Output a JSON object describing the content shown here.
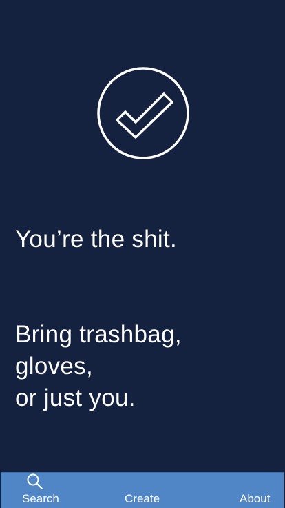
{
  "screen": {
    "background_color": "#15223f",
    "icon": "checkmark-circle-icon"
  },
  "message": {
    "headline": "You’re the shit.",
    "instruction_lines": [
      "Bring trashbag,",
      "gloves,",
      "or just you."
    ]
  },
  "tabbar": {
    "background_color": "#5085c6",
    "tabs": [
      {
        "label": "Search",
        "icon": "search-icon"
      },
      {
        "label": "Create"
      },
      {
        "label": "About"
      }
    ]
  }
}
